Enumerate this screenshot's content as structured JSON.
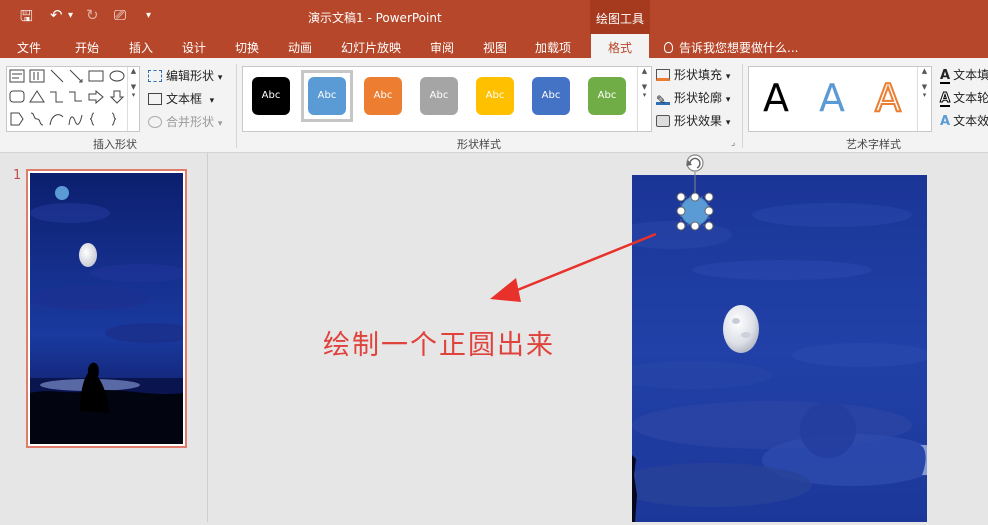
{
  "titlebar": {
    "title": "演示文稿1 - PowerPoint",
    "context_group": "绘图工具",
    "qa_save": "🖫",
    "qa_undo": "↶",
    "qa_undo_drop": "▾",
    "qa_redo": "↻",
    "qa_present": "⎚",
    "qa_customize": "▾"
  },
  "tabs": [
    {
      "label": "文件"
    },
    {
      "label": "开始"
    },
    {
      "label": "插入"
    },
    {
      "label": "设计"
    },
    {
      "label": "切换"
    },
    {
      "label": "动画"
    },
    {
      "label": "幻灯片放映"
    },
    {
      "label": "审阅"
    },
    {
      "label": "视图"
    },
    {
      "label": "加载项"
    },
    {
      "label": "格式"
    }
  ],
  "tell_me": "告诉我您想要做什么...",
  "ribbon": {
    "insert_shapes": {
      "label": "插入形状",
      "edit_shape": "编辑形状",
      "text_box": "文本框",
      "merge_shapes": "合并形状",
      "dropdown": "▾"
    },
    "shape_styles": {
      "label": "形状样式",
      "presets": [
        {
          "text": "Abc",
          "color": "#000000"
        },
        {
          "text": "Abc",
          "color": "#5b9bd5"
        },
        {
          "text": "Abc",
          "color": "#ed7d31"
        },
        {
          "text": "Abc",
          "color": "#a5a5a5"
        },
        {
          "text": "Abc",
          "color": "#ffc000"
        },
        {
          "text": "Abc",
          "color": "#4472c4"
        },
        {
          "text": "Abc",
          "color": "#70ad47"
        }
      ],
      "fill": "形状填充",
      "outline": "形状轮廓",
      "effects": "形状效果",
      "dropdown": "▾",
      "expand": "⌟"
    },
    "wordart": {
      "label": "艺术字样式",
      "letter": "A",
      "text_fill": "文本填",
      "text_outline": "文本轮",
      "text_effects": "文本效"
    }
  },
  "thumbnail": {
    "number": "1"
  },
  "annotation": "绘制一个正圆出来",
  "colors": {
    "accent": "#b7472a",
    "annotation": "#e0423c",
    "selected_shape": "#5b9bd5",
    "night_sky": "#1d3a9a"
  }
}
